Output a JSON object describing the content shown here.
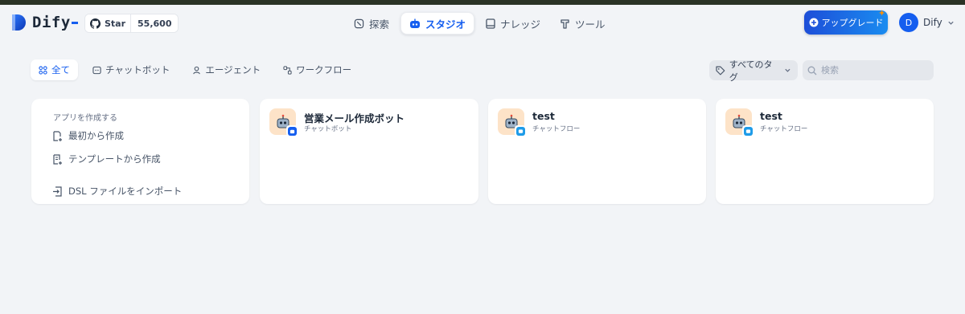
{
  "brand": {
    "name": "Dify",
    "accent": "#155eef"
  },
  "github": {
    "label": "Star",
    "count": "55,600"
  },
  "nav": [
    {
      "label": "探索",
      "icon": "compass-icon",
      "active": false
    },
    {
      "label": "スタジオ",
      "icon": "robot-icon",
      "active": true
    },
    {
      "label": "ナレッジ",
      "icon": "book-icon",
      "active": false
    },
    {
      "label": "ツール",
      "icon": "hammer-icon",
      "active": false
    }
  ],
  "upgrade_label": "アップグレード",
  "user": {
    "initial": "D",
    "name": "Dify"
  },
  "tabs": [
    {
      "label": "全て",
      "icon": "grid-icon",
      "active": true
    },
    {
      "label": "チャットボット",
      "icon": "chat-icon",
      "active": false
    },
    {
      "label": "エージェント",
      "icon": "agent-icon",
      "active": false
    },
    {
      "label": "ワークフロー",
      "icon": "workflow-icon",
      "active": false
    }
  ],
  "tag_filter": "すべてのタグ",
  "search": {
    "placeholder": "検索",
    "value": ""
  },
  "create": {
    "title": "アプリを作成する",
    "items": [
      "最初から作成",
      "テンプレートから作成",
      "DSL ファイルをインポート"
    ]
  },
  "apps": [
    {
      "name": "営業メール作成ボット",
      "type": "チャットボット",
      "badge_color": "#155eef"
    },
    {
      "name": "test",
      "type": "チャットフロー",
      "badge_color": "#1e9be8"
    },
    {
      "name": "test",
      "type": "チャットフロー",
      "badge_color": "#1e9be8"
    }
  ]
}
